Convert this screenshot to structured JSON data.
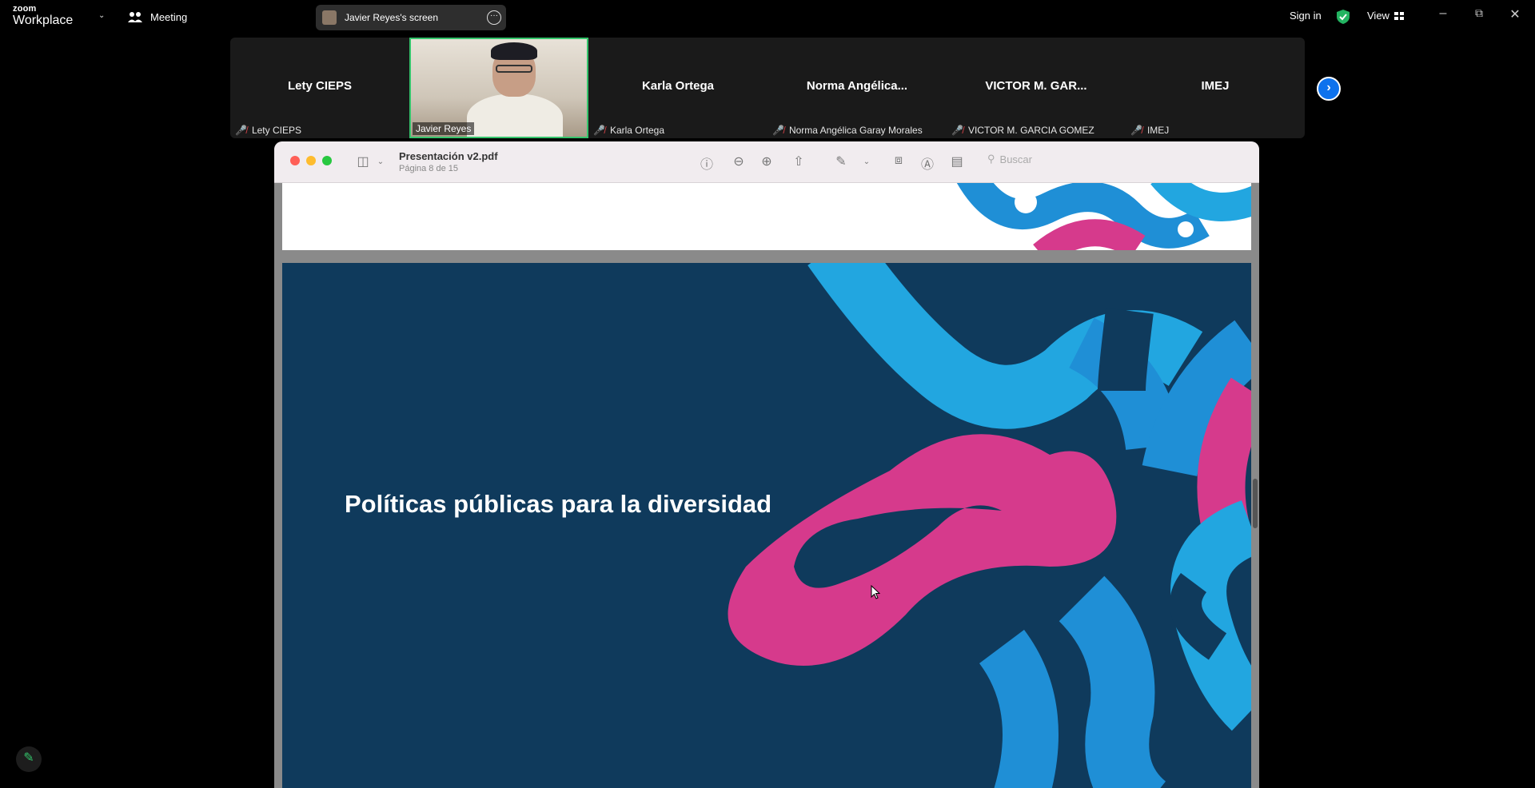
{
  "app": {
    "logo_top": "zoom",
    "logo_bottom": "Workplace",
    "meeting_label": "Meeting",
    "share_label": "Javier Reyes's screen",
    "signin_label": "Sign in",
    "view_label": "View"
  },
  "participants": [
    {
      "display": "Lety CIEPS",
      "name": "Lety CIEPS",
      "muted": true
    },
    {
      "display": "",
      "name": "Javier Reyes",
      "muted": false,
      "video": true
    },
    {
      "display": "Karla Ortega",
      "name": "Karla Ortega",
      "muted": true
    },
    {
      "display": "Norma  Angélica...",
      "name": "Norma Angélica Garay Morales",
      "muted": true
    },
    {
      "display": "VICTOR  M.  GAR...",
      "name": "VICTOR M. GARCIA GOMEZ",
      "muted": true
    },
    {
      "display": "IMEJ",
      "name": "IMEJ",
      "muted": true
    }
  ],
  "preview": {
    "title": "Presentación v2.pdf",
    "subtitle": "Página 8 de 15",
    "search_placeholder": "Buscar"
  },
  "slide": {
    "title": "Políticas públicas para la diversidad"
  },
  "colors": {
    "accent_green": "#34c46b",
    "next_blue": "#0e72ed",
    "slide_bg": "#0f3a5c",
    "slide_pink": "#d63a8c",
    "slide_blue": "#1f8fd6",
    "slide_cyan": "#22a6e0"
  }
}
